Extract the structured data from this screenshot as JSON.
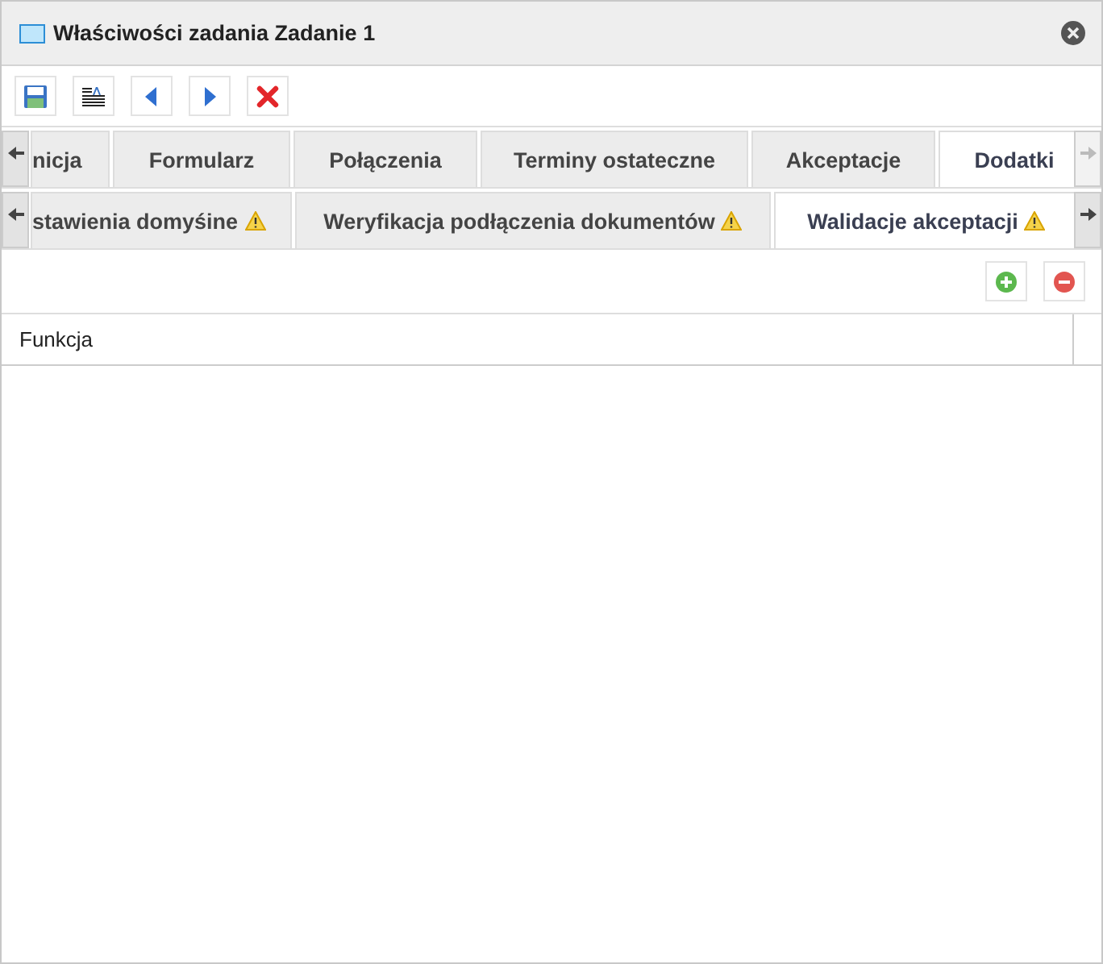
{
  "window": {
    "title": "Właściwości zadania Zadanie 1"
  },
  "toolbar": [
    {
      "kind": "save"
    },
    {
      "kind": "format"
    },
    {
      "kind": "previous"
    },
    {
      "kind": "next"
    },
    {
      "kind": "delete"
    }
  ],
  "tabs": {
    "scroll_left_disabled": false,
    "scroll_right_disabled": true,
    "items": [
      {
        "label": "nicja",
        "selected": false
      },
      {
        "label": "Formularz",
        "selected": false
      },
      {
        "label": "Połączenia",
        "selected": false
      },
      {
        "label": "Terminy ostateczne",
        "selected": false
      },
      {
        "label": "Akceptacje",
        "selected": false
      },
      {
        "label": "Dodatki",
        "selected": true
      }
    ]
  },
  "subtabs": {
    "scroll_left_disabled": false,
    "scroll_right_disabled": false,
    "items": [
      {
        "label": "stawienia domyśine",
        "selected": false,
        "warning": true
      },
      {
        "label": "Weryfikacja podłączenia dokumentów",
        "selected": false,
        "warning": true
      },
      {
        "label": "Walidacje akceptacji",
        "selected": true,
        "warning": true
      }
    ]
  },
  "grid": {
    "actions": [
      {
        "kind": "add"
      },
      {
        "kind": "remove"
      }
    ],
    "columns": [
      "Funkcja"
    ]
  }
}
